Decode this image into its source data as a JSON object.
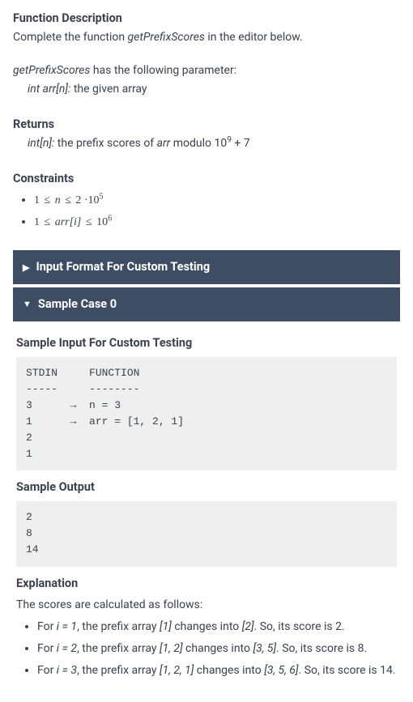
{
  "fnDesc": {
    "heading": "Function Description",
    "line1_a": "Complete the function ",
    "line1_fn": "getPrefixScores",
    "line1_b": " in the editor below.",
    "paramIntro_fn": "getPrefixScores",
    "paramIntro_tail": " has the following parameter:",
    "paramItem_sig": "int arr[n]:",
    "paramItem_desc": " the given array"
  },
  "returns": {
    "heading": "Returns",
    "sig": "int[n]:",
    "desc_a": " the prefix scores of ",
    "desc_arr": "arr",
    "desc_b": " modulo 10",
    "sup": "9",
    "desc_c": " + 7"
  },
  "constraints": {
    "heading": "Constraints",
    "c1_a": "1 ",
    "c1_le1": "≤",
    "c1_b": " n ",
    "c1_le2": "≤",
    "c1_c": " 2 ·10",
    "c1_sup": "5",
    "c2_a": "1 ",
    "c2_le1": "≤",
    "c2_b": " arr[i] ",
    "c2_le2": "≤",
    "c2_c": " 10",
    "c2_sup": "6"
  },
  "accordion1": {
    "arrow": "▶",
    "title": "Input Format For Custom Testing"
  },
  "accordion2": {
    "arrow": "▼",
    "title": "Sample Case 0"
  },
  "sample": {
    "inputHeading": "Sample Input For Custom Testing",
    "inputCode": "STDIN     FUNCTION\n-----     --------\n3      →  n = 3\n1      →  arr = [1, 2, 1]\n2\n1",
    "outputHeading": "Sample Output",
    "outputCode": "2\n8\n14",
    "explHeading": "Explanation",
    "explIntro": "The scores are calculated as follows:",
    "items": [
      {
        "a": "For ",
        "i1": "i = 1",
        "b": ", the prefix array ",
        "i2": "[1]",
        "c": " changes into ",
        "i3": "[2]",
        "d": ". So, its score is 2."
      },
      {
        "a": "For ",
        "i1": "i = 2",
        "b": ", the prefix array ",
        "i2": "[1, 2]",
        "c": " changes into ",
        "i3": "[3, 5]",
        "d": ". So, its score is 8."
      },
      {
        "a": "For ",
        "i1": "i = 3",
        "b": ", the prefix array ",
        "i2": "[1, 2, 1]",
        "c": " changes into ",
        "i3": "[3, 5, 6]",
        "d": ". So, its score is 14."
      }
    ]
  }
}
